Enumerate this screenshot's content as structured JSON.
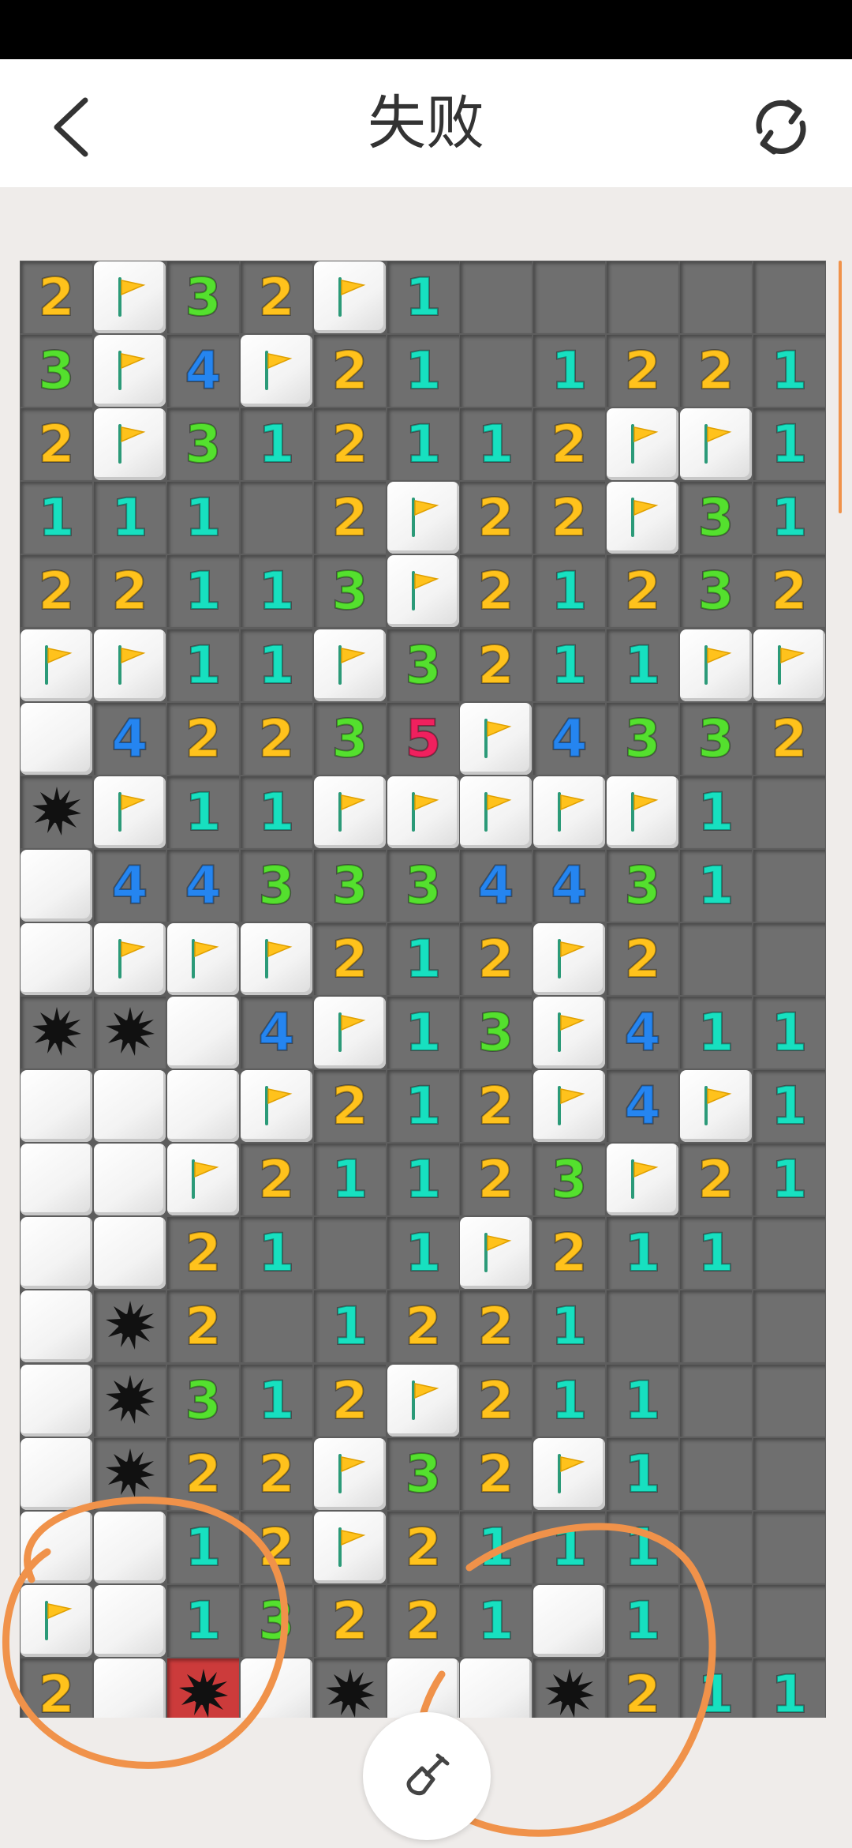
{
  "header": {
    "title": "失败"
  },
  "icons": {
    "back": "back-chevron-icon",
    "restart": "restart-icon",
    "dig": "shovel-icon",
    "flag": "flag-icon",
    "mine": "mine-icon"
  },
  "colors": {
    "n1": "#17e0c0",
    "n2": "#ffc21c",
    "n3": "#54e02e",
    "n4": "#2585f0",
    "n5": "#f0205e",
    "annotation": "#f0924a",
    "exploded": "#cc3b3b"
  },
  "board": {
    "cols": 11,
    "rows": [
      [
        "2",
        "F",
        "3",
        "2",
        "F",
        "1",
        "0",
        "0",
        "0",
        "0",
        "0"
      ],
      [
        "3",
        "F",
        "4",
        "F",
        "2",
        "1",
        "0",
        "1",
        "2",
        "2",
        "1"
      ],
      [
        "2",
        "F",
        "3",
        "1",
        "2",
        "1",
        "1",
        "2",
        "F",
        "F",
        "1"
      ],
      [
        "1",
        "1",
        "1",
        "0",
        "2",
        "F",
        "2",
        "2",
        "F",
        "3",
        "1"
      ],
      [
        "2",
        "2",
        "1",
        "1",
        "3",
        "F",
        "2",
        "1",
        "2",
        "3",
        "2"
      ],
      [
        "F",
        "F",
        "1",
        "1",
        "F",
        "3",
        "2",
        "1",
        "1",
        "F",
        "F"
      ],
      [
        "H",
        "4",
        "2",
        "2",
        "3",
        "5",
        "F",
        "4",
        "3",
        "3",
        "2"
      ],
      [
        "M",
        "F",
        "1",
        "1",
        "F",
        "F",
        "F",
        "F",
        "F",
        "1",
        "0"
      ],
      [
        "H",
        "4",
        "4",
        "3",
        "3",
        "3",
        "4",
        "4",
        "3",
        "1",
        "0"
      ],
      [
        "H",
        "F",
        "F",
        "F",
        "2",
        "1",
        "2",
        "F",
        "2",
        "0",
        "0"
      ],
      [
        "M",
        "M",
        "H",
        "4",
        "F",
        "1",
        "3",
        "F",
        "4",
        "1",
        "1"
      ],
      [
        "H",
        "H",
        "H",
        "F",
        "2",
        "1",
        "2",
        "F",
        "4",
        "F",
        "1"
      ],
      [
        "H",
        "H",
        "F",
        "2",
        "1",
        "1",
        "2",
        "3",
        "F",
        "2",
        "1"
      ],
      [
        "H",
        "H",
        "2",
        "1",
        "0",
        "1",
        "F",
        "2",
        "1",
        "1",
        "0"
      ],
      [
        "H",
        "M",
        "2",
        "0",
        "1",
        "2",
        "2",
        "1",
        "0",
        "0",
        "0"
      ],
      [
        "H",
        "M",
        "3",
        "1",
        "2",
        "F",
        "2",
        "1",
        "1",
        "0",
        "0"
      ],
      [
        "H",
        "M",
        "2",
        "2",
        "F",
        "3",
        "2",
        "F",
        "1",
        "0",
        "0"
      ],
      [
        "H",
        "H",
        "1",
        "2",
        "F",
        "2",
        "1",
        "1",
        "1",
        "0",
        "0"
      ],
      [
        "F",
        "H",
        "1",
        "3",
        "2",
        "2",
        "1",
        "H",
        "1",
        "0",
        "0"
      ],
      [
        "2",
        "H",
        "X",
        "H",
        "M",
        "H",
        "H",
        "M",
        "2",
        "1",
        "1"
      ]
    ]
  }
}
